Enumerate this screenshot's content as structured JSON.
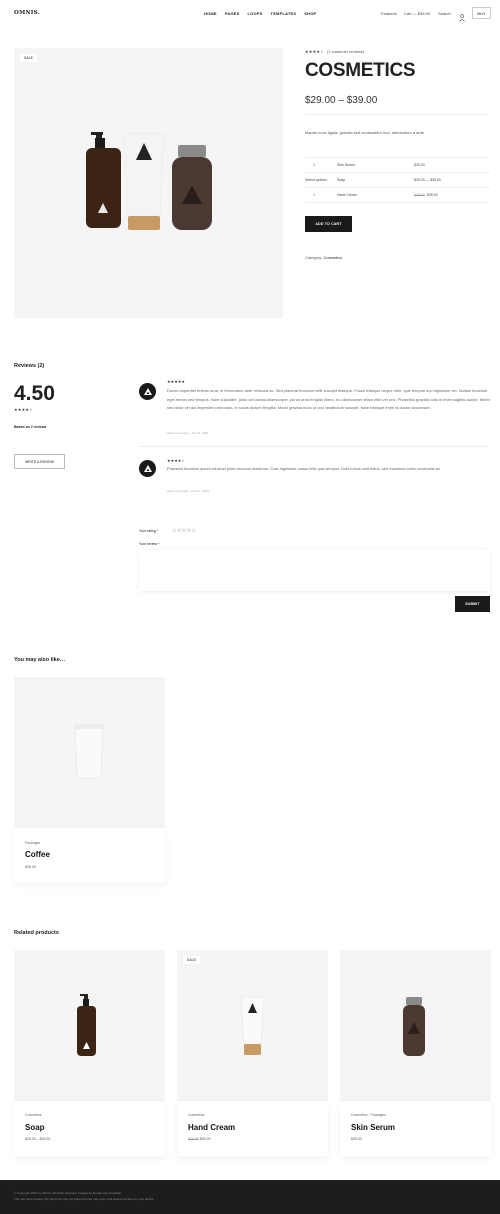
{
  "header": {
    "logo": "OMNIS.",
    "nav": [
      "HOME",
      "PAGES",
      "LOOPS",
      "TEMPLATES",
      "SHOP"
    ],
    "features": "Features",
    "cart": "Cart — $39.00",
    "search": "Search",
    "account_icon": "user-icon",
    "buy": "BUY"
  },
  "product": {
    "badge": "SALE",
    "rating_stars": "★★★★☆",
    "reviews_link": "(2 customer reviews)",
    "title": "COSMETICS",
    "price": "$29.00 – $39.00",
    "description": "Mauris nunc ligula, gravida sed consectetur non, elementum a ante.",
    "select_label": "Select options",
    "variations": [
      {
        "qty": "1",
        "name": "Skin Serum",
        "price": "$29.00"
      },
      {
        "qty": "",
        "name": "Soap",
        "price": "$29.00 — $39.00"
      },
      {
        "qty": "1",
        "name": "Hand Cream",
        "price_old": "$39.00",
        "price": "$30.00"
      }
    ],
    "add_to_cart": "ADD TO CART",
    "category_label": "Category:",
    "category": "Cosmetics"
  },
  "reviews": {
    "title": "Reviews (2)",
    "average": "4.50",
    "avg_stars": "★★★★☆",
    "based_on": "Based on 2 reviews",
    "write_button": "WRITE A REVIEW",
    "items": [
      {
        "stars": "★★★★★",
        "text": "Donec imperdiet finibus urna, in fermentum ante vehicula ac. Sed placerat tincidunt velit suscipit tristique. Fusce tristique neque nibh, quis tempus orci dignissim vel. Nullam tincidunt eget metus sed tempus. Nam vulputate, justo vel lacinia ullamcorper, purus urna fringilla libero, eu ullamcorper tellus nibh vel orci. Phasellus gravida odio id enim sagittis auctor. Morbi sed dolor vel dui imperdiet commodo, in sociis dictum fringilla. Morbi gravida nunc ut orci vestibulum suscipit. Nam tristique enim id ductor accumsan.",
        "meta": "Admin Lumpeth – Jan 21, 2021"
      },
      {
        "stars": "★★★★☆",
        "text": "Praesent faucibus ipsum sit amet justo rhoncus maximus. Cras dignissim varius felis quis tempus. Duis luctus velit tellus, sed maximus lorem venenatis ac.",
        "meta": "Admin Lumpeth – Feb 21, 2021"
      }
    ],
    "your_rating": "Your rating *",
    "rating_empty": "☆☆☆☆☆",
    "your_review": "Your review *",
    "submit": "SUBMIT"
  },
  "also_like": {
    "title": "You may also like…",
    "items": [
      {
        "category": "Packages",
        "name": "Coffee",
        "price": "$39.00"
      }
    ]
  },
  "related": {
    "title": "Related products",
    "items": [
      {
        "category": "Cosmetics",
        "name": "Soap",
        "price": "$29.00 – $39.00",
        "badge": ""
      },
      {
        "category": "Cosmetics",
        "name": "Hand Cream",
        "price_old": "$39.00",
        "price": "$30.00",
        "badge": "SALE"
      },
      {
        "category": "Cosmetics · Packages",
        "name": "Skin Serum",
        "price": "$29.00",
        "badge": ""
      }
    ]
  },
  "footer": {
    "line1": "© Copyright 2021 by Omnis. All rights reserved. Images by Envato and unsplash.",
    "line2": "This site uses cookies. By using this site you agree that we may store and access cookies on your device."
  },
  "colors": {
    "dark": "#1a1a1a",
    "panel": "#f5f5f5",
    "footer": "#1d1d1d"
  }
}
